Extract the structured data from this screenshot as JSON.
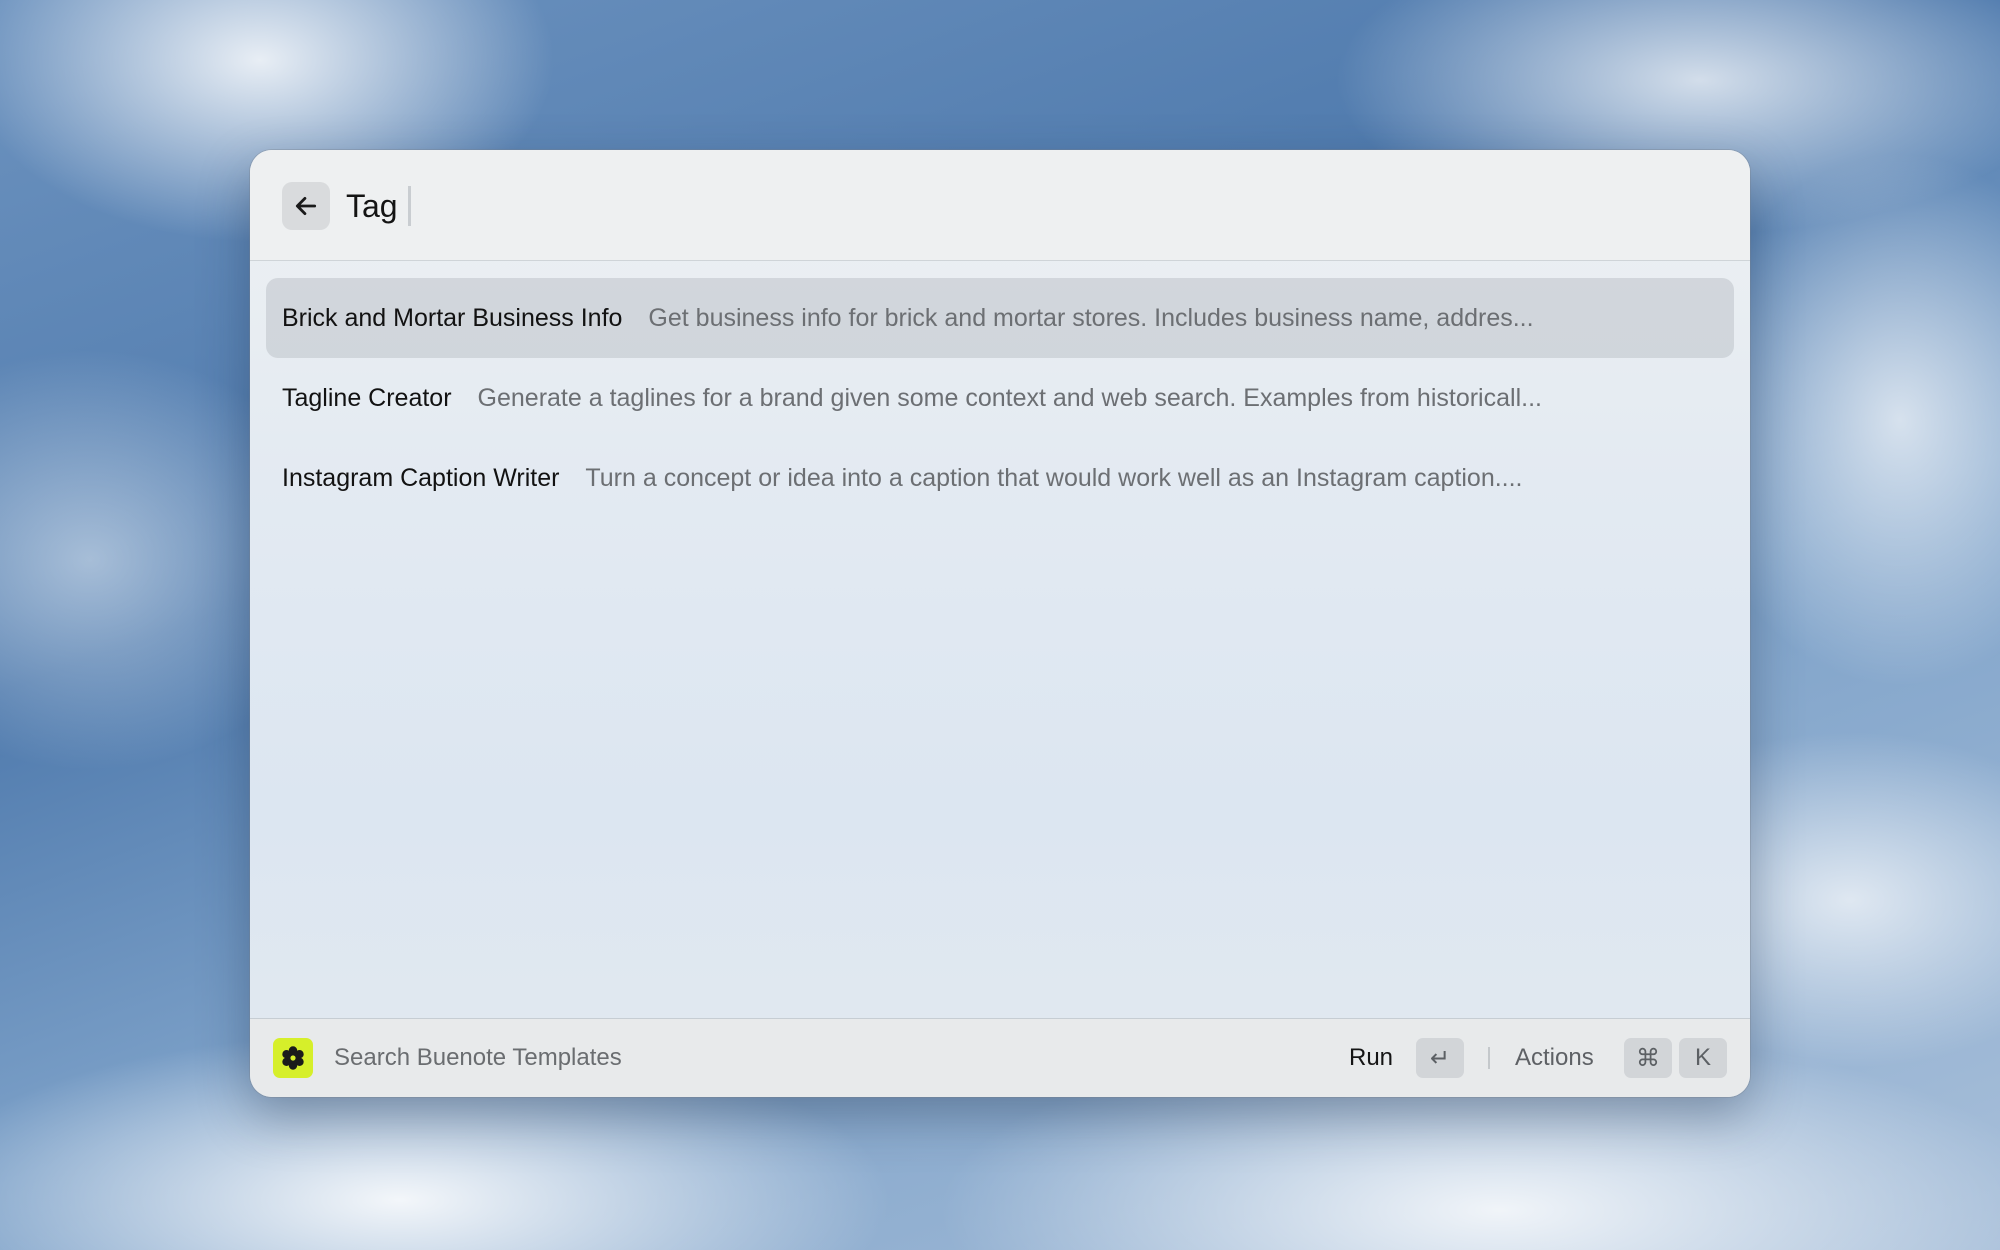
{
  "header": {
    "back_icon": "arrow-left-icon",
    "query": "Tag"
  },
  "results": [
    {
      "title": "Brick and Mortar Business Info",
      "description": "Get business info for brick and mortar stores. Includes business name, addres...",
      "selected": true
    },
    {
      "title": "Tagline Creator",
      "description": "Generate a taglines for a brand given some context and web search. Examples from historicall...",
      "selected": false
    },
    {
      "title": "Instagram Caption Writer",
      "description": "Turn a concept or idea into a caption that would work well as an Instagram caption....",
      "selected": false
    }
  ],
  "footer": {
    "app_icon": "buenote-logo-icon",
    "app_icon_color": "#d6ef2a",
    "label": "Search Buenote Templates",
    "run_label": "Run",
    "enter_key": "↵",
    "actions_label": "Actions",
    "cmd_key": "⌘",
    "k_key": "K"
  }
}
